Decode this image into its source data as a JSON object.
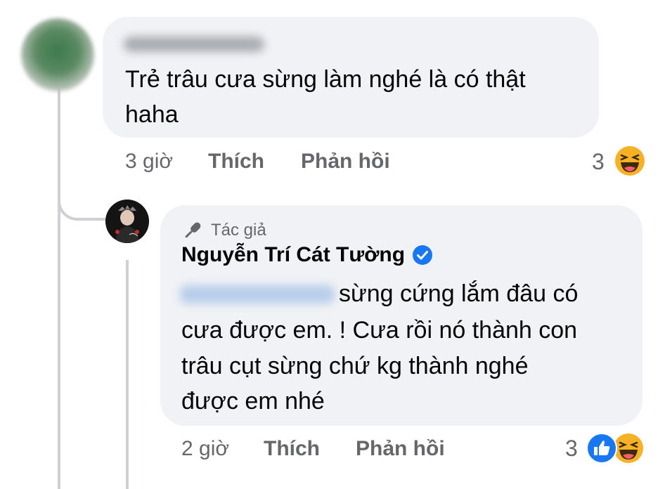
{
  "comment1": {
    "author_hidden": true,
    "text": "Trẻ trâu cưa sừng làm nghé là có thật haha",
    "line1": "Trẻ trâu cưa sừng làm nghé là có thật",
    "line2": "haha",
    "time": "3 giờ",
    "like_label": "Thích",
    "reply_label": "Phản hồi",
    "reaction_count": "3",
    "reactions": [
      "haha-icon"
    ]
  },
  "reply1": {
    "badge": "Tác giả",
    "author": "Nguyễn Trí Cát Tường",
    "verified": true,
    "mention_hidden": true,
    "line1": "sừng cứng lắm đâu có",
    "line2": "cưa được em. ! Cưa rồi nó thành con",
    "line3": "trâu cụt sừng chứ kg thành nghé",
    "line4": "được em nhé",
    "time": "2 giờ",
    "like_label": "Thích",
    "reply_label": "Phản hồi",
    "reaction_count": "3",
    "reactions": [
      "like-icon",
      "haha-icon"
    ]
  },
  "colors": {
    "bubble": "#f0f2f5",
    "meta_text": "#65676b",
    "verified_blue": "#1877f2",
    "thread_line": "#ced0d4"
  }
}
